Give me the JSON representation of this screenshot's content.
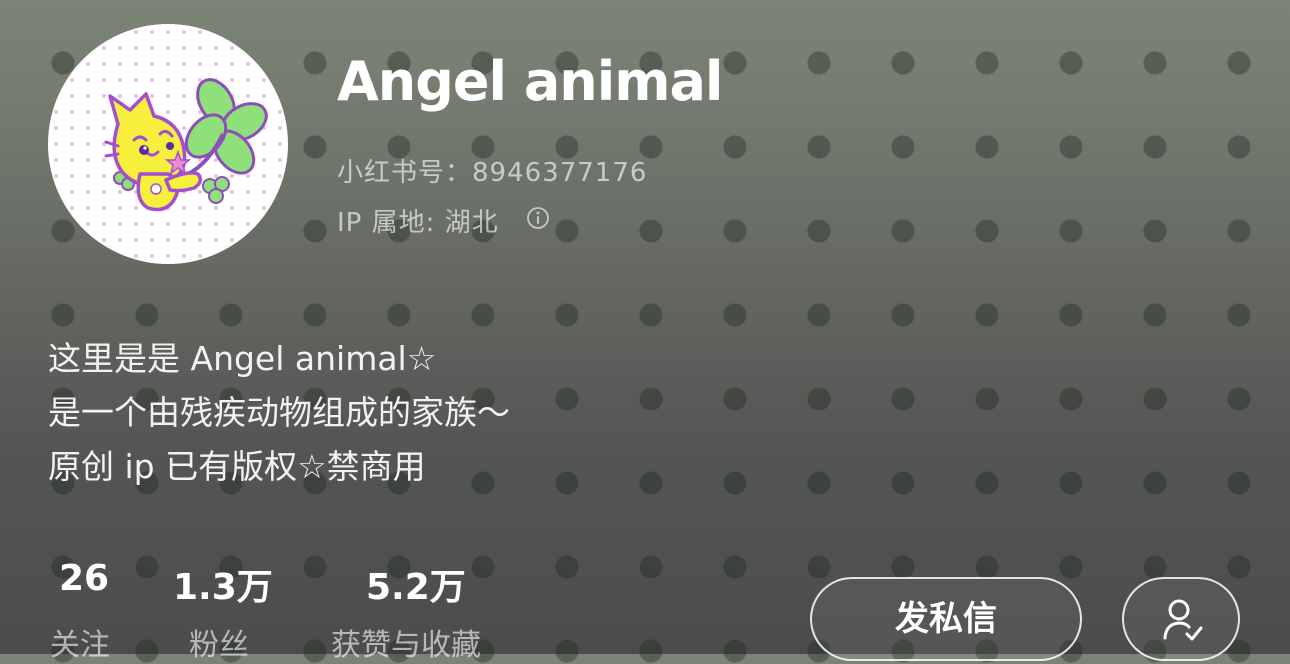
{
  "profile": {
    "avatar_icon": "cat-with-clover-avatar",
    "name": "Angel animal",
    "id_line": "小红书号：8946377176",
    "ip_line": "IP 属地: 湖北",
    "info_icon": "info-circle-icon"
  },
  "bio": {
    "lines": [
      "这里是是 Angel animal☆",
      "是一个由残疾动物组成的家族～",
      "原创 ip 已有版权☆禁商用"
    ]
  },
  "stats": [
    {
      "value": "26",
      "label": "关注"
    },
    {
      "value": "1.3万",
      "label": "粉丝"
    },
    {
      "value": "5.2万",
      "label": "获赞与收藏"
    }
  ],
  "actions": {
    "message_label": "发私信",
    "followed_icon": "user-check-icon"
  },
  "colors": {
    "avatar_yellow": "#f5ef3a",
    "avatar_green": "#7fdc6a",
    "avatar_purple": "#b04fd6",
    "avatar_pink": "#e98bd6"
  }
}
